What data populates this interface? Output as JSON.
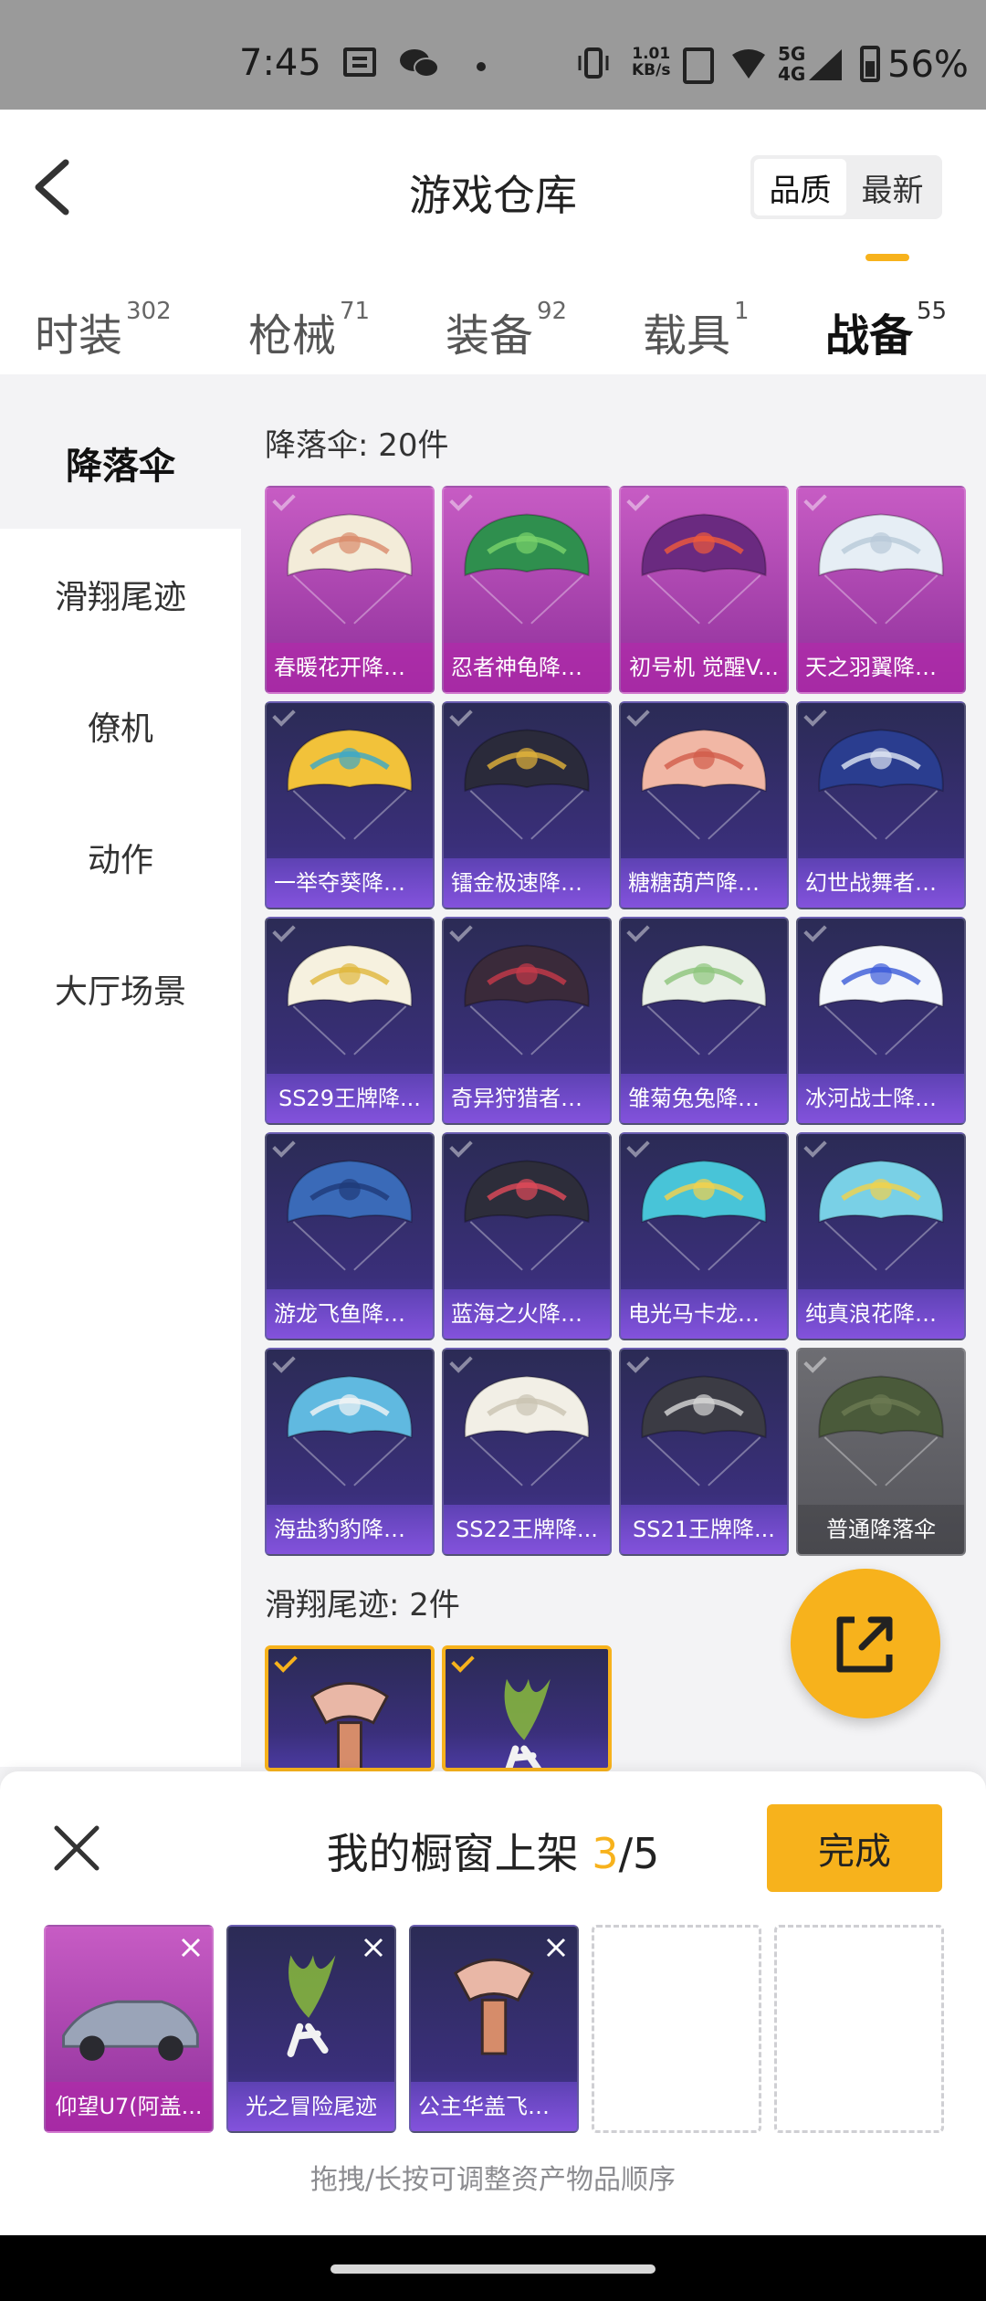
{
  "status_bar": {
    "time": "7:45",
    "net_speed_value": "1.01",
    "net_speed_unit": "KB/s",
    "net_type_top": "5G",
    "net_type_bottom": "4G",
    "battery": "56%"
  },
  "header": {
    "title": "游戏仓库",
    "sort_options": [
      "品质",
      "最新"
    ],
    "sort_selected": "品质"
  },
  "tabs": [
    {
      "label": "时装",
      "count": "302"
    },
    {
      "label": "枪械",
      "count": "71"
    },
    {
      "label": "装备",
      "count": "92"
    },
    {
      "label": "载具",
      "count": "1"
    },
    {
      "label": "战备",
      "count": "55"
    }
  ],
  "active_tab": "战备",
  "sidebar": {
    "items": [
      {
        "label": "降落伞"
      },
      {
        "label": "滑翔尾迹"
      },
      {
        "label": "僚机"
      },
      {
        "label": "动作"
      },
      {
        "label": "大厅场景"
      }
    ],
    "active": "降落伞"
  },
  "sections": [
    {
      "label": "降落伞: 20件",
      "items": [
        {
          "name": "春暖花开降落...",
          "rarity": "legendary"
        },
        {
          "name": "忍者神龟降落...",
          "rarity": "legendary"
        },
        {
          "name": "初号机 觉醒V...",
          "rarity": "legendary"
        },
        {
          "name": "天之羽翼降落...",
          "rarity": "legendary"
        },
        {
          "name": "一举夺葵降落...",
          "rarity": "epic"
        },
        {
          "name": "镭金极速降落...",
          "rarity": "epic"
        },
        {
          "name": "糖糖葫芦降落...",
          "rarity": "epic"
        },
        {
          "name": "幻世战舞者降...",
          "rarity": "epic"
        },
        {
          "name": "SS29王牌降...",
          "rarity": "epic"
        },
        {
          "name": "奇异狩猎者降...",
          "rarity": "epic"
        },
        {
          "name": "雏菊兔兔降落...",
          "rarity": "epic"
        },
        {
          "name": "冰河战士降落...",
          "rarity": "epic"
        },
        {
          "name": "游龙飞鱼降落...",
          "rarity": "epic"
        },
        {
          "name": "蓝海之火降落...",
          "rarity": "epic"
        },
        {
          "name": "电光马卡龙降...",
          "rarity": "epic"
        },
        {
          "name": "纯真浪花降落...",
          "rarity": "epic"
        },
        {
          "name": "海盐豹豹降落...",
          "rarity": "epic"
        },
        {
          "name": "SS22王牌降...",
          "rarity": "epic"
        },
        {
          "name": "SS21王牌降...",
          "rarity": "epic"
        },
        {
          "name": "普通降落伞",
          "rarity": "common"
        }
      ]
    },
    {
      "label": "滑翔尾迹: 2件",
      "items": [
        {
          "name": "",
          "rarity": "epic",
          "selected": true
        },
        {
          "name": "",
          "rarity": "epic",
          "selected": true
        }
      ]
    }
  ],
  "showcase": {
    "title_prefix": "我的橱窗上架 ",
    "count": "3",
    "total": "/5",
    "done_label": "完成",
    "slots": [
      {
        "name": "仰望U7(阿盖...",
        "rarity": "legendary"
      },
      {
        "name": "光之冒险尾迹",
        "rarity": "epic"
      },
      {
        "name": "公主华盖飞行...",
        "rarity": "epic"
      },
      {
        "name": "",
        "rarity": "empty"
      },
      {
        "name": "",
        "rarity": "empty"
      }
    ],
    "hint": "拖拽/长按可调整资产物品顺序"
  },
  "colors": {
    "accent": "#f7b21c",
    "legendary": "#a63fb0",
    "epic": "#3a2f7a",
    "common": "#5c5c62"
  },
  "icons": [
    "back-icon",
    "share-icon",
    "close-icon",
    "remove-icon",
    "check-icon"
  ]
}
